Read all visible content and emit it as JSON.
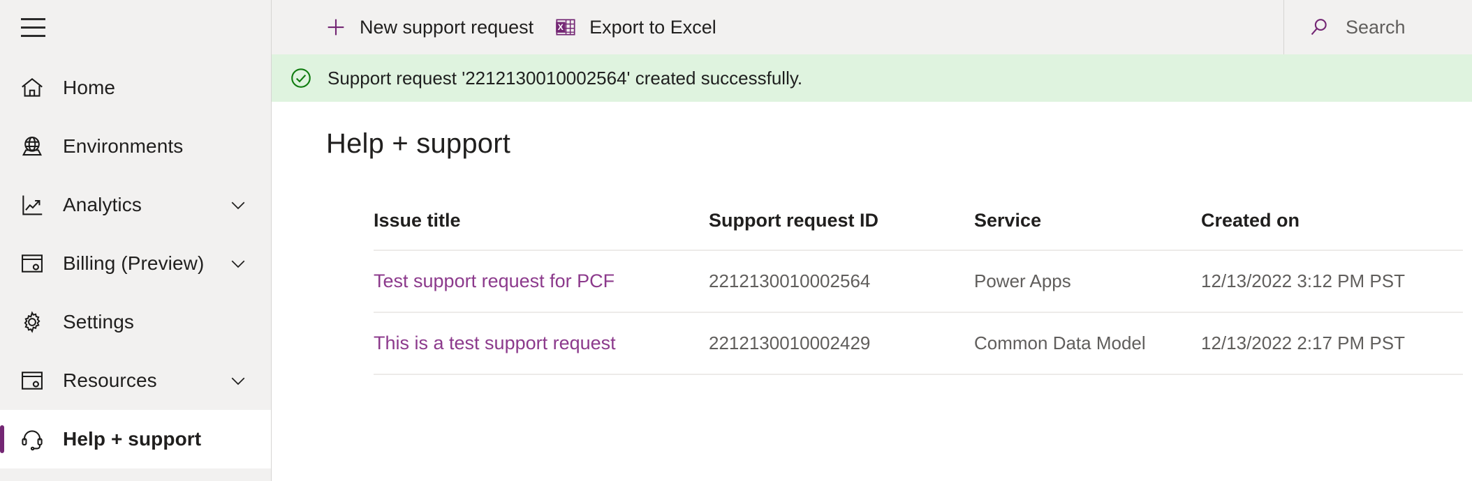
{
  "sidebar": {
    "menu_icon": "hamburger-icon",
    "items": [
      {
        "label": "Home",
        "icon": "home-icon",
        "expandable": false,
        "selected": false
      },
      {
        "label": "Environments",
        "icon": "globe-icon",
        "expandable": false,
        "selected": false
      },
      {
        "label": "Analytics",
        "icon": "chart-line-icon",
        "expandable": true,
        "selected": false
      },
      {
        "label": "Billing (Preview)",
        "icon": "billing-icon",
        "expandable": true,
        "selected": false
      },
      {
        "label": "Settings",
        "icon": "gear-icon",
        "expandable": false,
        "selected": false
      },
      {
        "label": "Resources",
        "icon": "resources-icon",
        "expandable": true,
        "selected": false
      },
      {
        "label": "Help + support",
        "icon": "headset-icon",
        "expandable": false,
        "selected": true
      }
    ]
  },
  "command_bar": {
    "new_request_label": "New support request",
    "new_request_icon": "plus-icon",
    "export_label": "Export to Excel",
    "export_icon": "excel-icon",
    "search_label": "Search",
    "search_icon": "search-icon"
  },
  "banner": {
    "icon": "success-check-icon",
    "message": "Support request '2212130010002564' created successfully.",
    "background_color": "#dff3df",
    "icon_color": "#107c10"
  },
  "page": {
    "title": "Help + support"
  },
  "table": {
    "columns": [
      "Issue title",
      "Support request ID",
      "Service",
      "Created on"
    ],
    "rows": [
      {
        "issue_title": "Test support request for PCF",
        "support_request_id": "2212130010002564",
        "service": "Power Apps",
        "created_on": "12/13/2022 3:12 PM PST"
      },
      {
        "issue_title": "This is a test support request",
        "support_request_id": "2212130010002429",
        "service": "Common Data Model",
        "created_on": "12/13/2022 2:17 PM PST"
      }
    ]
  },
  "colors": {
    "accent_purple": "#742774",
    "link_purple": "#8c3a8c",
    "sidebar_bg": "#f2f1f0",
    "success_green": "#107c10"
  }
}
